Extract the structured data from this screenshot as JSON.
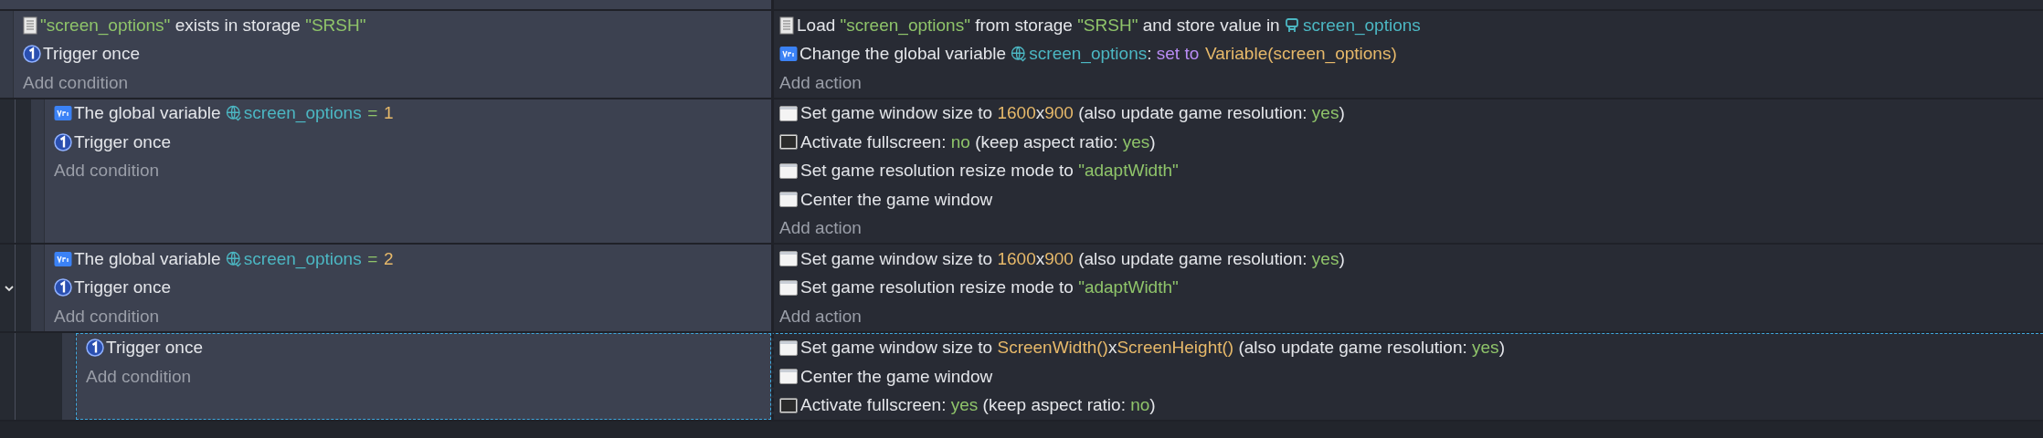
{
  "events": [
    {
      "selected": false,
      "conditions": [
        {
          "kind": "storage",
          "parts": [
            {
              "kind": "string",
              "text": "\"screen_options\""
            },
            {
              "kind": "plain",
              "text": " exists in storage "
            },
            {
              "kind": "string",
              "text": "\"SRSH\""
            }
          ]
        },
        {
          "kind": "once",
          "parts": [
            {
              "kind": "plain",
              "text": "Trigger once"
            }
          ]
        }
      ],
      "add_condition": "Add condition",
      "actions": [
        {
          "kind": "storage",
          "parts": [
            {
              "kind": "plain",
              "text": "Load "
            },
            {
              "kind": "string",
              "text": "\"screen_options\""
            },
            {
              "kind": "plain",
              "text": " from storage "
            },
            {
              "kind": "string",
              "text": "\"SRSH\""
            },
            {
              "kind": "plain",
              "text": " and store value in "
            },
            {
              "kind": "scene_var",
              "text": "screen_options"
            }
          ]
        },
        {
          "kind": "var",
          "parts": [
            {
              "kind": "plain",
              "text": "Change the global variable "
            },
            {
              "kind": "global_var",
              "text": "screen_options"
            },
            {
              "kind": "plain",
              "text": ": "
            },
            {
              "kind": "operator",
              "text": "set to"
            },
            {
              "kind": "number",
              "text": "Variable(screen_options)"
            }
          ]
        }
      ],
      "add_action": "Add action",
      "children": [
        {
          "selected": false,
          "conditions": [
            {
              "kind": "var",
              "parts": [
                {
                  "kind": "plain",
                  "text": "The global variable "
                },
                {
                  "kind": "global_var",
                  "text": "screen_options"
                },
                {
                  "kind": "string",
                  "text": "="
                },
                {
                  "kind": "number",
                  "text": "1"
                }
              ]
            },
            {
              "kind": "once",
              "parts": [
                {
                  "kind": "plain",
                  "text": "Trigger once"
                }
              ]
            }
          ],
          "add_condition": "Add condition",
          "actions": [
            {
              "kind": "window",
              "parts": [
                {
                  "kind": "plain",
                  "text": "Set game window size to "
                },
                {
                  "kind": "number",
                  "text": "1600"
                },
                {
                  "kind": "plain",
                  "text": "x"
                },
                {
                  "kind": "number",
                  "text": "900"
                },
                {
                  "kind": "plain",
                  "text": " (also update game resolution: "
                },
                {
                  "kind": "string",
                  "text": "yes"
                },
                {
                  "kind": "plain",
                  "text": ")"
                }
              ]
            },
            {
              "kind": "fullscreen",
              "parts": [
                {
                  "kind": "plain",
                  "text": "Activate fullscreen: "
                },
                {
                  "kind": "string",
                  "text": "no"
                },
                {
                  "kind": "plain",
                  "text": " (keep aspect ratio: "
                },
                {
                  "kind": "string",
                  "text": "yes"
                },
                {
                  "kind": "plain",
                  "text": ")"
                }
              ]
            },
            {
              "kind": "window",
              "parts": [
                {
                  "kind": "plain",
                  "text": "Set game resolution resize mode to "
                },
                {
                  "kind": "string",
                  "text": "\"adaptWidth\""
                }
              ]
            },
            {
              "kind": "window",
              "parts": [
                {
                  "kind": "plain",
                  "text": "Center the game window"
                }
              ]
            }
          ],
          "add_action": "Add action"
        },
        {
          "selected": false,
          "expanded": true,
          "conditions": [
            {
              "kind": "var",
              "parts": [
                {
                  "kind": "plain",
                  "text": "The global variable "
                },
                {
                  "kind": "global_var",
                  "text": "screen_options"
                },
                {
                  "kind": "string",
                  "text": "="
                },
                {
                  "kind": "number",
                  "text": "2"
                }
              ]
            },
            {
              "kind": "once",
              "parts": [
                {
                  "kind": "plain",
                  "text": "Trigger once"
                }
              ]
            }
          ],
          "add_condition": "Add condition",
          "actions": [
            {
              "kind": "window",
              "parts": [
                {
                  "kind": "plain",
                  "text": "Set game window size to "
                },
                {
                  "kind": "number",
                  "text": "1600"
                },
                {
                  "kind": "plain",
                  "text": "x"
                },
                {
                  "kind": "number",
                  "text": "900"
                },
                {
                  "kind": "plain",
                  "text": " (also update game resolution: "
                },
                {
                  "kind": "string",
                  "text": "yes"
                },
                {
                  "kind": "plain",
                  "text": ")"
                }
              ]
            },
            {
              "kind": "window",
              "parts": [
                {
                  "kind": "plain",
                  "text": "Set game resolution resize mode to "
                },
                {
                  "kind": "string",
                  "text": "\"adaptWidth\""
                }
              ]
            }
          ],
          "add_action": "Add action",
          "children": [
            {
              "selected": true,
              "conditions": [
                {
                  "kind": "once",
                  "parts": [
                    {
                      "kind": "plain",
                      "text": "Trigger once"
                    }
                  ]
                }
              ],
              "add_condition": "Add condition",
              "actions": [
                {
                  "kind": "window",
                  "parts": [
                    {
                      "kind": "plain",
                      "text": "Set game window size to "
                    },
                    {
                      "kind": "number",
                      "text": "ScreenWidth()"
                    },
                    {
                      "kind": "plain",
                      "text": "x"
                    },
                    {
                      "kind": "number",
                      "text": "ScreenHeight()"
                    },
                    {
                      "kind": "plain",
                      "text": " (also update game resolution: "
                    },
                    {
                      "kind": "string",
                      "text": "yes"
                    },
                    {
                      "kind": "plain",
                      "text": ")"
                    }
                  ]
                },
                {
                  "kind": "window",
                  "parts": [
                    {
                      "kind": "plain",
                      "text": "Center the game window"
                    }
                  ]
                },
                {
                  "kind": "fullscreen",
                  "parts": [
                    {
                      "kind": "plain",
                      "text": "Activate fullscreen: "
                    },
                    {
                      "kind": "string",
                      "text": "yes"
                    },
                    {
                      "kind": "plain",
                      "text": " (keep aspect ratio: "
                    },
                    {
                      "kind": "string",
                      "text": "no"
                    },
                    {
                      "kind": "plain",
                      "text": ")"
                    }
                  ]
                }
              ]
            }
          ]
        }
      ]
    }
  ]
}
